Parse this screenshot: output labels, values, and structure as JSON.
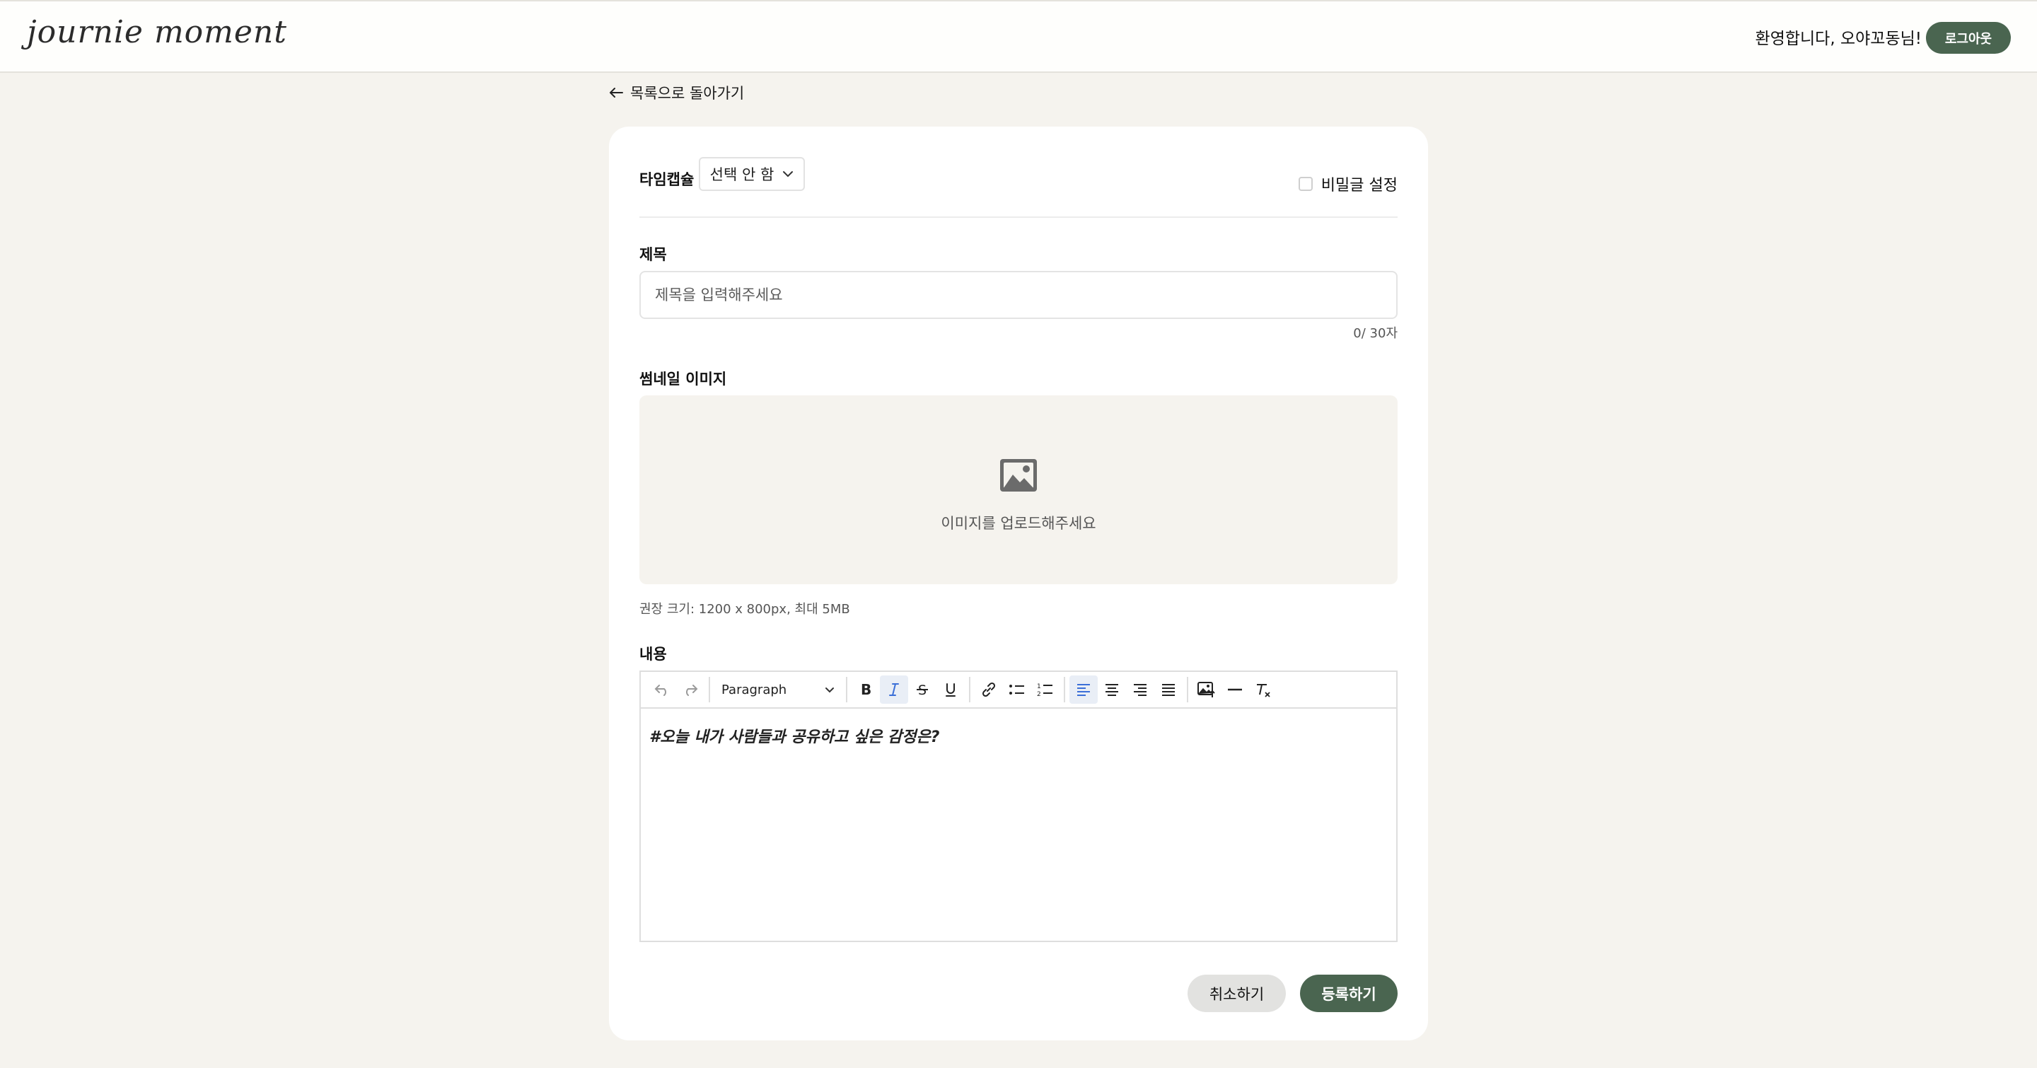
{
  "header": {
    "logo": "journie moment",
    "welcome": "환영합니다, 오야꼬동님!",
    "logout_label": "로그아웃"
  },
  "nav": {
    "back_label": "목록으로 돌아가기"
  },
  "form": {
    "timecapsule_label": "타임캡슐",
    "timecapsule_value": "선택 안 함",
    "secret_label": "비밀글 설정",
    "secret_checked": false,
    "title_label": "제목",
    "title_placeholder": "제목을 입력해주세요",
    "title_value": "",
    "title_count": "0/ 30자",
    "thumbnail_label": "썸네일 이미지",
    "upload_text": "이미지를 업로드해주세요",
    "thumbnail_hint": "권장 크기: 1200 x 800px, 최대 5MB",
    "content_label": "내용",
    "editor_block_type": "Paragraph",
    "editor_content": "#오늘 내가 사람들과 공유하고 싶은 감정은?",
    "cancel_label": "취소하기",
    "submit_label": "등록하기"
  },
  "toolbar": {
    "icons": [
      "undo-icon",
      "redo-icon",
      "bold-icon",
      "italic-icon",
      "strikethrough-icon",
      "underline-icon",
      "link-icon",
      "bullet-list-icon",
      "numbered-list-icon",
      "align-left-icon",
      "align-center-icon",
      "align-right-icon",
      "align-justify-icon",
      "image-upload-icon",
      "horizontal-rule-icon",
      "clear-format-icon"
    ],
    "active": [
      "italic-icon",
      "align-left-icon"
    ]
  },
  "colors": {
    "page_bg": "#f5f3ee",
    "primary": "#4a6550",
    "active_blue": "#3b6fd8"
  }
}
